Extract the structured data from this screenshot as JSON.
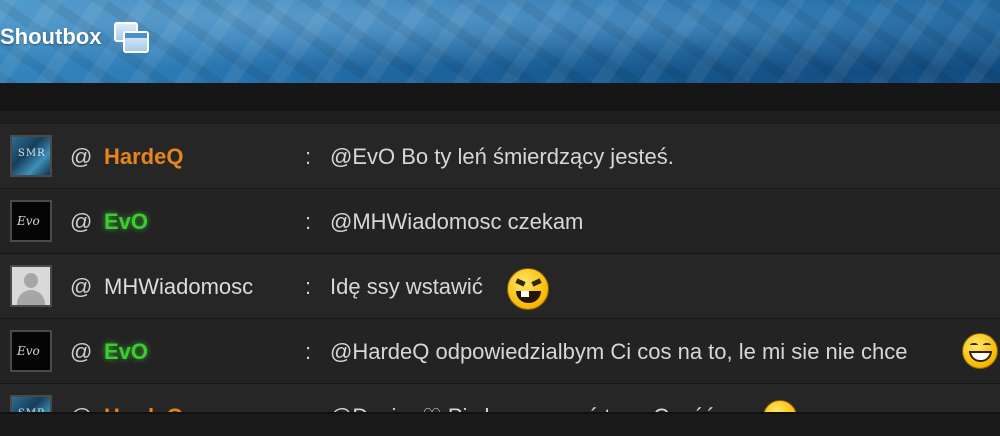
{
  "header": {
    "title": "Shoutbox",
    "icon": "windows-icon"
  },
  "messages": [
    {
      "avatar": "art-avatar",
      "at": "@",
      "nick": "HardeQ",
      "nick_color": "#e8841e",
      "colon": ":",
      "text": "@EvO Bo ty leń śmierdzący jesteś."
    },
    {
      "avatar": "evo-logo-avatar",
      "at": "@",
      "nick": "EvO",
      "nick_color": "#3ccc32",
      "colon": ":",
      "text": "@MHWiadomosc czekam"
    },
    {
      "avatar": "default-avatar",
      "at": "@",
      "nick": "MHWiadomosc",
      "nick_color": "#dcdcdc",
      "colon": ":",
      "text": "Idę ssy wstawić",
      "emoji": "evil-grin-smiley-icon"
    },
    {
      "avatar": "evo-logo-avatar",
      "at": "@",
      "nick": "EvO",
      "nick_color": "#3ccc32",
      "colon": ":",
      "text": "@HardeQ odpowiedzialbym Ci cos na to, le mi sie nie chce",
      "emoji": "laughing-smiley-icon"
    },
    {
      "avatar": "art-avatar",
      "at": "@",
      "nick": "HardeQ",
      "nick_color": "#e8841e",
      "colon": ":",
      "text": "@Desire ♡ Pis low ozy coś tam. Cześć",
      "emoji": "smiley-icon"
    }
  ]
}
